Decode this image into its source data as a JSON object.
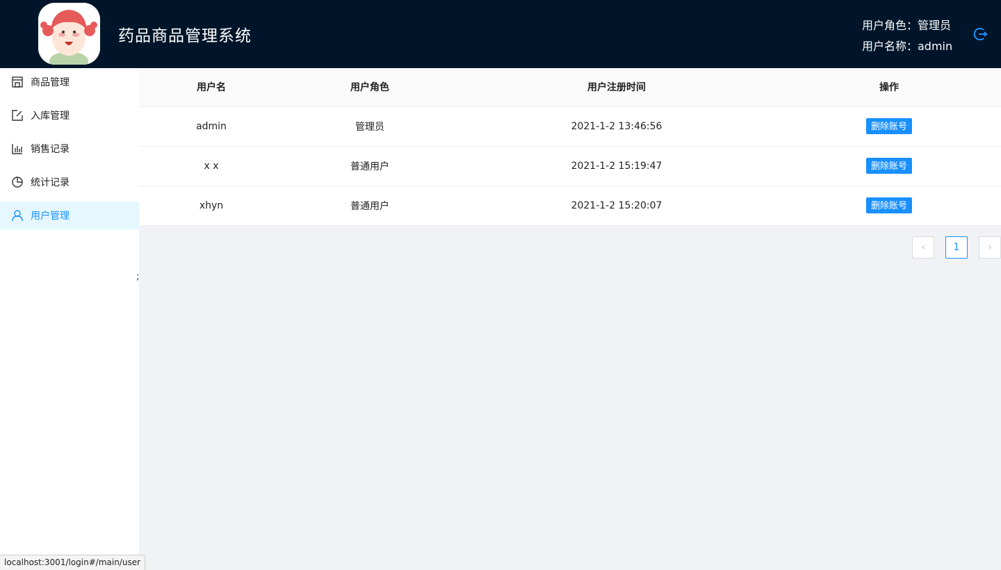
{
  "header": {
    "title": "药品商品管理系统",
    "role_line": "用户角色：管理员",
    "name_line": "用户名称：admin",
    "logout_icon": "logout-icon"
  },
  "sidebar": {
    "items": [
      {
        "label": "商品管理",
        "icon": "shop-icon",
        "active": false
      },
      {
        "label": "入库管理",
        "icon": "edit-icon",
        "active": false
      },
      {
        "label": "销售记录",
        "icon": "bar-chart-icon",
        "active": false
      },
      {
        "label": "统计记录",
        "icon": "pie-chart-icon",
        "active": false
      },
      {
        "label": "用户管理",
        "icon": "user-icon",
        "active": true
      }
    ]
  },
  "table": {
    "columns": [
      "用户名",
      "用户角色",
      "用户注册时间",
      "操作"
    ],
    "rows": [
      {
        "username": "admin",
        "role": "管理员",
        "time": "2021-1-2 13:46:56",
        "action": "删除账号"
      },
      {
        "username": "x x",
        "role": "普通用户",
        "time": "2021-1-2 15:19:47",
        "action": "删除账号"
      },
      {
        "username": "xhyn",
        "role": "普通用户",
        "time": "2021-1-2 15:20:07",
        "action": "删除账号"
      }
    ]
  },
  "pagination": {
    "prev": "‹",
    "current": "1",
    "next": "›"
  },
  "stray_text": ";",
  "status_url": "localhost:3001/login#/main/user",
  "colors": {
    "header_bg": "#001529",
    "accent": "#1890ff",
    "active_bg": "#e6f7ff"
  }
}
